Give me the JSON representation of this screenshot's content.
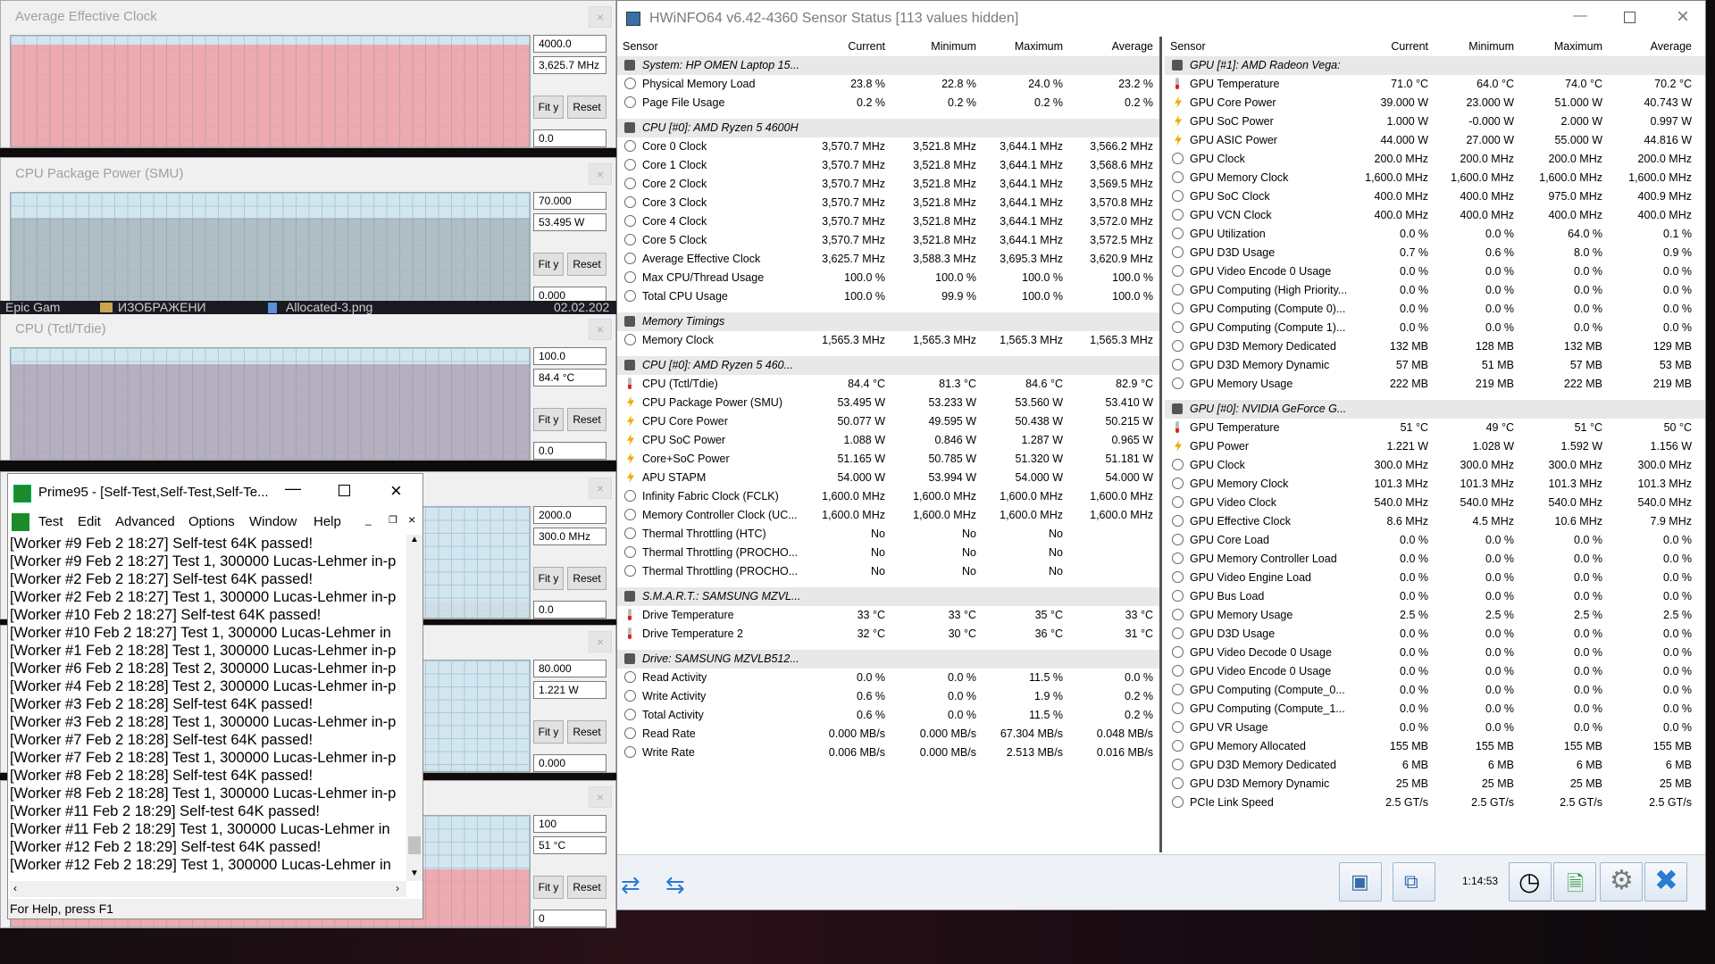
{
  "graphs": [
    {
      "title": "Average Effective Clock",
      "max": "4000.0",
      "cur": "3,625.7 MHz",
      "min": "0.0",
      "fity": "Fit y",
      "reset": "Reset",
      "fill_fraction": 0.906,
      "fill": "#f2a0a6"
    },
    {
      "title": "CPU Package Power (SMU)",
      "max": "70.000",
      "cur": "53.495 W",
      "min": "0.000",
      "fity": "Fit y",
      "reset": "Reset",
      "fill_fraction": 0.764,
      "fill": "#aab8be"
    },
    {
      "title": "CPU (Tctl/Tdie)",
      "max": "100.0",
      "cur": "84.4 °C",
      "min": "0.0",
      "fity": "Fit y",
      "reset": "Reset",
      "fill_fraction": 0.844,
      "fill": "#b2a6b8"
    },
    {
      "title": "",
      "max": "2000.0",
      "cur": "300.0 MHz",
      "min": "0.0",
      "fity": "Fit y",
      "reset": "Reset",
      "fill_fraction": 0.15,
      "fill": "#cfdde6"
    },
    {
      "title": "",
      "max": "80.000",
      "cur": "1.221 W",
      "min": "0.000",
      "fity": "Fit y",
      "reset": "Reset",
      "fill_fraction": 0.015,
      "fill": "#cfdde6"
    },
    {
      "title": "",
      "max": "100",
      "cur": "51 °C",
      "min": "0",
      "fity": "Fit y",
      "reset": "Reset",
      "fill_fraction": 0.51,
      "fill": "#f2a0a6"
    }
  ],
  "desktop": {
    "item1": "Epic Gam",
    "item2": "ИЗОБРАЖЕНИ",
    "item3": "Allocated-3.png",
    "item4": "02.02.202"
  },
  "prime95": {
    "title": "Prime95 - [Self-Test,Self-Test,Self-Te...",
    "menu": [
      "Test",
      "Edit",
      "Advanced",
      "Options",
      "Window",
      "Help"
    ],
    "log": [
      "[Worker #9 Feb 2 18:27] Self-test 64K passed!",
      "[Worker #9 Feb 2 18:27] Test 1, 300000 Lucas-Lehmer in-p",
      "[Worker #2 Feb 2 18:27] Self-test 64K passed!",
      "[Worker #2 Feb 2 18:27] Test 1, 300000 Lucas-Lehmer in-p",
      "[Worker #10 Feb 2 18:27] Self-test 64K passed!",
      "[Worker #10 Feb 2 18:27] Test 1, 300000 Lucas-Lehmer in",
      "[Worker #1 Feb 2 18:28] Test 1, 300000 Lucas-Lehmer in-p",
      "[Worker #6 Feb 2 18:28] Test 2, 300000 Lucas-Lehmer in-p",
      "[Worker #4 Feb 2 18:28] Test 2, 300000 Lucas-Lehmer in-p",
      "[Worker #3 Feb 2 18:28] Self-test 64K passed!",
      "[Worker #3 Feb 2 18:28] Test 1, 300000 Lucas-Lehmer in-p",
      "[Worker #7 Feb 2 18:28] Self-test 64K passed!",
      "[Worker #7 Feb 2 18:28] Test 1, 300000 Lucas-Lehmer in-p",
      "[Worker #8 Feb 2 18:28] Self-test 64K passed!",
      "[Worker #8 Feb 2 18:28] Test 1, 300000 Lucas-Lehmer in-p",
      "[Worker #11 Feb 2 18:29] Self-test 64K passed!",
      "[Worker #11 Feb 2 18:29] Test 1, 300000 Lucas-Lehmer in",
      "[Worker #12 Feb 2 18:29] Self-test 64K passed!",
      "[Worker #12 Feb 2 18:29] Test 1, 300000 Lucas-Lehmer in"
    ],
    "status": "For Help, press F1"
  },
  "hwinfo": {
    "title": "HWiNFO64 v6.42-4360 Sensor Status [113 values hidden]",
    "elapsed": "1:14:53",
    "cols": [
      "Sensor",
      "Current",
      "Minimum",
      "Maximum",
      "Average"
    ],
    "left": [
      {
        "g": 1,
        "n": "System: HP OMEN Laptop 15..."
      },
      {
        "i": "c",
        "n": "Physical Memory Load",
        "v": [
          "23.8 %",
          "22.8 %",
          "24.0 %",
          "23.2 %"
        ]
      },
      {
        "i": "c",
        "n": "Page File Usage",
        "v": [
          "0.2 %",
          "0.2 %",
          "0.2 %",
          "0.2 %"
        ]
      },
      {
        "b": 1
      },
      {
        "g": 1,
        "n": "CPU [#0]: AMD Ryzen 5 4600H"
      },
      {
        "i": "c",
        "n": "Core 0 Clock",
        "v": [
          "3,570.7 MHz",
          "3,521.8 MHz",
          "3,644.1 MHz",
          "3,566.2 MHz"
        ]
      },
      {
        "i": "c",
        "n": "Core 1 Clock",
        "v": [
          "3,570.7 MHz",
          "3,521.8 MHz",
          "3,644.1 MHz",
          "3,568.6 MHz"
        ]
      },
      {
        "i": "c",
        "n": "Core 2 Clock",
        "v": [
          "3,570.7 MHz",
          "3,521.8 MHz",
          "3,644.1 MHz",
          "3,569.5 MHz"
        ]
      },
      {
        "i": "c",
        "n": "Core 3 Clock",
        "v": [
          "3,570.7 MHz",
          "3,521.8 MHz",
          "3,644.1 MHz",
          "3,570.8 MHz"
        ]
      },
      {
        "i": "c",
        "n": "Core 4 Clock",
        "v": [
          "3,570.7 MHz",
          "3,521.8 MHz",
          "3,644.1 MHz",
          "3,572.0 MHz"
        ]
      },
      {
        "i": "c",
        "n": "Core 5 Clock",
        "v": [
          "3,570.7 MHz",
          "3,521.8 MHz",
          "3,644.1 MHz",
          "3,572.5 MHz"
        ]
      },
      {
        "i": "c",
        "n": "Average Effective Clock",
        "v": [
          "3,625.7 MHz",
          "3,588.3 MHz",
          "3,695.3 MHz",
          "3,620.9 MHz"
        ]
      },
      {
        "i": "c",
        "n": "Max CPU/Thread Usage",
        "v": [
          "100.0 %",
          "100.0 %",
          "100.0 %",
          "100.0 %"
        ]
      },
      {
        "i": "c",
        "n": "Total CPU Usage",
        "v": [
          "100.0 %",
          "99.9 %",
          "100.0 %",
          "100.0 %"
        ]
      },
      {
        "b": 1
      },
      {
        "g": 1,
        "n": "Memory Timings"
      },
      {
        "i": "c",
        "n": "Memory Clock",
        "v": [
          "1,565.3 MHz",
          "1,565.3 MHz",
          "1,565.3 MHz",
          "1,565.3 MHz"
        ]
      },
      {
        "b": 1
      },
      {
        "g": 1,
        "n": "CPU [#0]: AMD Ryzen 5 460..."
      },
      {
        "i": "t",
        "n": "CPU (Tctl/Tdie)",
        "v": [
          "84.4 °C",
          "81.3 °C",
          "84.6 °C",
          "82.9 °C"
        ]
      },
      {
        "i": "b",
        "n": "CPU Package Power (SMU)",
        "v": [
          "53.495 W",
          "53.233 W",
          "53.560 W",
          "53.410 W"
        ]
      },
      {
        "i": "b",
        "n": "CPU Core Power",
        "v": [
          "50.077 W",
          "49.595 W",
          "50.438 W",
          "50.215 W"
        ]
      },
      {
        "i": "b",
        "n": "CPU SoC Power",
        "v": [
          "1.088 W",
          "0.846 W",
          "1.287 W",
          "0.965 W"
        ]
      },
      {
        "i": "b",
        "n": "Core+SoC Power",
        "v": [
          "51.165 W",
          "50.785 W",
          "51.320 W",
          "51.181 W"
        ]
      },
      {
        "i": "b",
        "n": "APU STAPM",
        "v": [
          "54.000 W",
          "53.994 W",
          "54.000 W",
          "54.000 W"
        ]
      },
      {
        "i": "c",
        "n": "Infinity Fabric Clock (FCLK)",
        "v": [
          "1,600.0 MHz",
          "1,600.0 MHz",
          "1,600.0 MHz",
          "1,600.0 MHz"
        ]
      },
      {
        "i": "c",
        "n": "Memory Controller Clock (UC...",
        "v": [
          "1,600.0 MHz",
          "1,600.0 MHz",
          "1,600.0 MHz",
          "1,600.0 MHz"
        ]
      },
      {
        "i": "c",
        "n": "Thermal Throttling (HTC)",
        "v": [
          "No",
          "No",
          "No",
          ""
        ]
      },
      {
        "i": "c",
        "n": "Thermal Throttling (PROCHO...",
        "v": [
          "No",
          "No",
          "No",
          ""
        ]
      },
      {
        "i": "c",
        "n": "Thermal Throttling (PROCHO...",
        "v": [
          "No",
          "No",
          "No",
          ""
        ]
      },
      {
        "b": 1
      },
      {
        "g": 1,
        "n": "S.M.A.R.T.: SAMSUNG MZVL..."
      },
      {
        "i": "t",
        "n": "Drive Temperature",
        "v": [
          "33 °C",
          "33 °C",
          "35 °C",
          "33 °C"
        ]
      },
      {
        "i": "t",
        "n": "Drive Temperature 2",
        "v": [
          "32 °C",
          "30 °C",
          "36 °C",
          "31 °C"
        ]
      },
      {
        "b": 1
      },
      {
        "g": 1,
        "n": "Drive: SAMSUNG MZVLB512..."
      },
      {
        "i": "c",
        "n": "Read Activity",
        "v": [
          "0.0 %",
          "0.0 %",
          "11.5 %",
          "0.0 %"
        ]
      },
      {
        "i": "c",
        "n": "Write Activity",
        "v": [
          "0.6 %",
          "0.0 %",
          "1.9 %",
          "0.2 %"
        ]
      },
      {
        "i": "c",
        "n": "Total Activity",
        "v": [
          "0.6 %",
          "0.0 %",
          "11.5 %",
          "0.2 %"
        ]
      },
      {
        "i": "c",
        "n": "Read Rate",
        "v": [
          "0.000 MB/s",
          "0.000 MB/s",
          "67.304 MB/s",
          "0.048 MB/s"
        ]
      },
      {
        "i": "c",
        "n": "Write Rate",
        "v": [
          "0.006 MB/s",
          "0.000 MB/s",
          "2.513 MB/s",
          "0.016 MB/s"
        ]
      }
    ],
    "right": [
      {
        "g": 1,
        "n": "GPU [#1]: AMD Radeon Vega:"
      },
      {
        "i": "t",
        "n": "GPU Temperature",
        "v": [
          "71.0 °C",
          "64.0 °C",
          "74.0 °C",
          "70.2 °C"
        ]
      },
      {
        "i": "b",
        "n": "GPU Core Power",
        "v": [
          "39.000 W",
          "23.000 W",
          "51.000 W",
          "40.743 W"
        ]
      },
      {
        "i": "b",
        "n": "GPU SoC Power",
        "v": [
          "1.000 W",
          "-0.000 W",
          "2.000 W",
          "0.997 W"
        ]
      },
      {
        "i": "b",
        "n": "GPU ASIC Power",
        "v": [
          "44.000 W",
          "27.000 W",
          "55.000 W",
          "44.816 W"
        ]
      },
      {
        "i": "c",
        "n": "GPU Clock",
        "v": [
          "200.0 MHz",
          "200.0 MHz",
          "200.0 MHz",
          "200.0 MHz"
        ]
      },
      {
        "i": "c",
        "n": "GPU Memory Clock",
        "v": [
          "1,600.0 MHz",
          "1,600.0 MHz",
          "1,600.0 MHz",
          "1,600.0 MHz"
        ]
      },
      {
        "i": "c",
        "n": "GPU SoC Clock",
        "v": [
          "400.0 MHz",
          "400.0 MHz",
          "975.0 MHz",
          "400.9 MHz"
        ]
      },
      {
        "i": "c",
        "n": "GPU VCN Clock",
        "v": [
          "400.0 MHz",
          "400.0 MHz",
          "400.0 MHz",
          "400.0 MHz"
        ]
      },
      {
        "i": "c",
        "n": "GPU Utilization",
        "v": [
          "0.0 %",
          "0.0 %",
          "64.0 %",
          "0.1 %"
        ]
      },
      {
        "i": "c",
        "n": "GPU D3D Usage",
        "v": [
          "0.7 %",
          "0.6 %",
          "8.0 %",
          "0.9 %"
        ]
      },
      {
        "i": "c",
        "n": "GPU Video Encode 0 Usage",
        "v": [
          "0.0 %",
          "0.0 %",
          "0.0 %",
          "0.0 %"
        ]
      },
      {
        "i": "c",
        "n": "GPU Computing (High Priority...",
        "v": [
          "0.0 %",
          "0.0 %",
          "0.0 %",
          "0.0 %"
        ]
      },
      {
        "i": "c",
        "n": "GPU Computing (Compute 0)...",
        "v": [
          "0.0 %",
          "0.0 %",
          "0.0 %",
          "0.0 %"
        ]
      },
      {
        "i": "c",
        "n": "GPU Computing (Compute 1)...",
        "v": [
          "0.0 %",
          "0.0 %",
          "0.0 %",
          "0.0 %"
        ]
      },
      {
        "i": "c",
        "n": "GPU D3D Memory Dedicated",
        "v": [
          "132 MB",
          "128 MB",
          "132 MB",
          "129 MB"
        ]
      },
      {
        "i": "c",
        "n": "GPU D3D Memory Dynamic",
        "v": [
          "57 MB",
          "51 MB",
          "57 MB",
          "53 MB"
        ]
      },
      {
        "i": "c",
        "n": "GPU Memory Usage",
        "v": [
          "222 MB",
          "219 MB",
          "222 MB",
          "219 MB"
        ]
      },
      {
        "b": 1
      },
      {
        "g": 1,
        "n": "GPU [#0]: NVIDIA GeForce G..."
      },
      {
        "i": "t",
        "n": "GPU Temperature",
        "v": [
          "51 °C",
          "49 °C",
          "51 °C",
          "50 °C"
        ]
      },
      {
        "i": "b",
        "n": "GPU Power",
        "v": [
          "1.221 W",
          "1.028 W",
          "1.592 W",
          "1.156 W"
        ]
      },
      {
        "i": "c",
        "n": "GPU Clock",
        "v": [
          "300.0 MHz",
          "300.0 MHz",
          "300.0 MHz",
          "300.0 MHz"
        ]
      },
      {
        "i": "c",
        "n": "GPU Memory Clock",
        "v": [
          "101.3 MHz",
          "101.3 MHz",
          "101.3 MHz",
          "101.3 MHz"
        ]
      },
      {
        "i": "c",
        "n": "GPU Video Clock",
        "v": [
          "540.0 MHz",
          "540.0 MHz",
          "540.0 MHz",
          "540.0 MHz"
        ]
      },
      {
        "i": "c",
        "n": "GPU Effective Clock",
        "v": [
          "8.6 MHz",
          "4.5 MHz",
          "10.6 MHz",
          "7.9 MHz"
        ]
      },
      {
        "i": "c",
        "n": "GPU Core Load",
        "v": [
          "0.0 %",
          "0.0 %",
          "0.0 %",
          "0.0 %"
        ]
      },
      {
        "i": "c",
        "n": "GPU Memory Controller Load",
        "v": [
          "0.0 %",
          "0.0 %",
          "0.0 %",
          "0.0 %"
        ]
      },
      {
        "i": "c",
        "n": "GPU Video Engine Load",
        "v": [
          "0.0 %",
          "0.0 %",
          "0.0 %",
          "0.0 %"
        ]
      },
      {
        "i": "c",
        "n": "GPU Bus Load",
        "v": [
          "0.0 %",
          "0.0 %",
          "0.0 %",
          "0.0 %"
        ]
      },
      {
        "i": "c",
        "n": "GPU Memory Usage",
        "v": [
          "2.5 %",
          "2.5 %",
          "2.5 %",
          "2.5 %"
        ]
      },
      {
        "i": "c",
        "n": "GPU D3D Usage",
        "v": [
          "0.0 %",
          "0.0 %",
          "0.0 %",
          "0.0 %"
        ]
      },
      {
        "i": "c",
        "n": "GPU Video Decode 0 Usage",
        "v": [
          "0.0 %",
          "0.0 %",
          "0.0 %",
          "0.0 %"
        ]
      },
      {
        "i": "c",
        "n": "GPU Video Encode 0 Usage",
        "v": [
          "0.0 %",
          "0.0 %",
          "0.0 %",
          "0.0 %"
        ]
      },
      {
        "i": "c",
        "n": "GPU Computing (Compute_0...",
        "v": [
          "0.0 %",
          "0.0 %",
          "0.0 %",
          "0.0 %"
        ]
      },
      {
        "i": "c",
        "n": "GPU Computing (Compute_1...",
        "v": [
          "0.0 %",
          "0.0 %",
          "0.0 %",
          "0.0 %"
        ]
      },
      {
        "i": "c",
        "n": "GPU VR Usage",
        "v": [
          "0.0 %",
          "0.0 %",
          "0.0 %",
          "0.0 %"
        ]
      },
      {
        "i": "c",
        "n": "GPU Memory Allocated",
        "v": [
          "155 MB",
          "155 MB",
          "155 MB",
          "155 MB"
        ]
      },
      {
        "i": "c",
        "n": "GPU D3D Memory Dedicated",
        "v": [
          "6 MB",
          "6 MB",
          "6 MB",
          "6 MB"
        ]
      },
      {
        "i": "c",
        "n": "GPU D3D Memory Dynamic",
        "v": [
          "25 MB",
          "25 MB",
          "25 MB",
          "25 MB"
        ]
      },
      {
        "i": "c",
        "n": "PCIe Link Speed",
        "v": [
          "2.5 GT/s",
          "2.5 GT/s",
          "2.5 GT/s",
          "2.5 GT/s"
        ]
      }
    ]
  }
}
